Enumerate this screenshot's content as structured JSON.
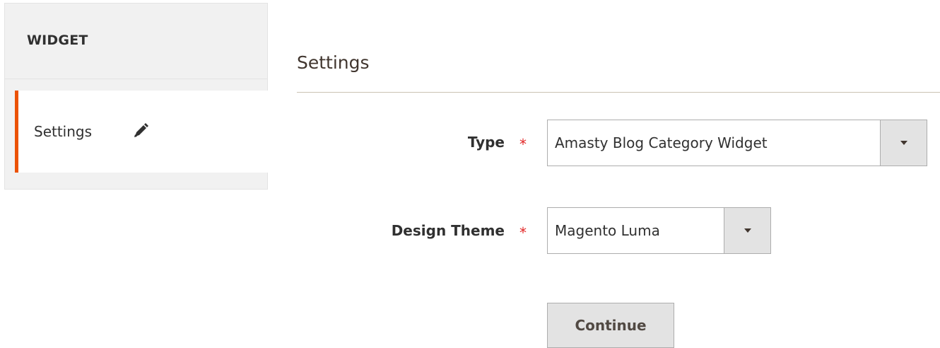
{
  "sidebar": {
    "title": "WIDGET",
    "items": [
      {
        "label": "Settings",
        "icon": "pencil-icon",
        "active": true
      }
    ],
    "accent_color": "#eb5202"
  },
  "main": {
    "section_title": "Settings",
    "fields": [
      {
        "label": "Type",
        "required": "*",
        "value": "Amasty Blog Category Widget"
      },
      {
        "label": "Design Theme",
        "required": "*",
        "value": "Magento Luma"
      }
    ],
    "continue_label": "Continue"
  },
  "colors": {
    "required": "#e22626",
    "button_bg": "#e3e3e3"
  }
}
